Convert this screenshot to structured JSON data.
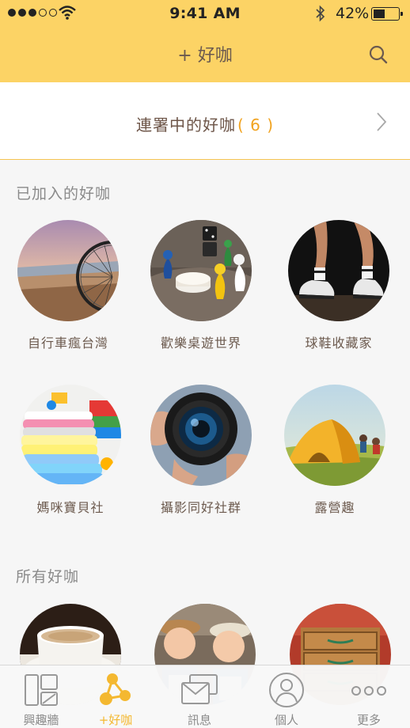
{
  "status_bar": {
    "time": "9:41 AM",
    "battery_percent": "42%",
    "battery_level": 0.42
  },
  "nav": {
    "title": "+ 好咖",
    "search_icon": "search-icon"
  },
  "banner": {
    "label": "連署中的好咖",
    "count": "( 6 )",
    "chevron_icon": "chevron-right-icon"
  },
  "joined": {
    "title": "已加入的好咖",
    "items": [
      {
        "label": "自行車瘋台灣"
      },
      {
        "label": "歡樂桌遊世界"
      },
      {
        "label": "球鞋收藏家"
      },
      {
        "label": "媽咪寶貝社"
      },
      {
        "label": "攝影同好社群"
      },
      {
        "label": "露營趣"
      }
    ]
  },
  "all": {
    "title": "所有好咖"
  },
  "tabbar": {
    "tabs": [
      {
        "label": "興趣牆",
        "icon": "wall-icon",
        "active": false
      },
      {
        "label": "+好咖",
        "icon": "share-nodes-icon",
        "active": true
      },
      {
        "label": "訊息",
        "icon": "message-icon",
        "active": false
      },
      {
        "label": "個人",
        "icon": "profile-icon",
        "active": false
      },
      {
        "label": "更多",
        "icon": "more-icon",
        "active": false
      }
    ]
  },
  "colors": {
    "header": "#fcd365",
    "accent": "#f4b830",
    "count": "#f1a320"
  }
}
